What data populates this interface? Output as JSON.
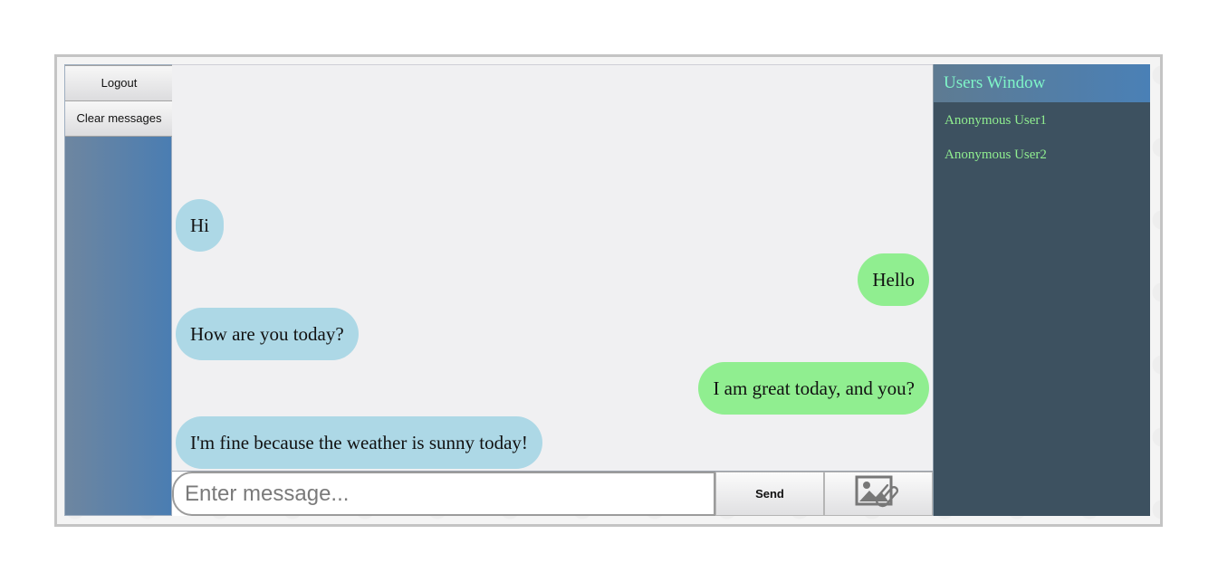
{
  "sidebar": {
    "buttons": [
      {
        "label": "Logout"
      },
      {
        "label": "Clear messages"
      }
    ]
  },
  "chat": {
    "messages": [
      {
        "text": "Hi",
        "direction": "incoming",
        "color": "#add8e6"
      },
      {
        "text": "Hello",
        "direction": "outgoing",
        "color": "#90ee90"
      },
      {
        "text": "How are you today?",
        "direction": "incoming",
        "color": "#add8e6"
      },
      {
        "text": "I am great today, and you?",
        "direction": "outgoing",
        "color": "#90ee90"
      },
      {
        "text": "I'm fine because the weather is sunny today!",
        "direction": "incoming",
        "color": "#add8e6"
      }
    ]
  },
  "composer": {
    "placeholder": "Enter message...",
    "value": "",
    "send_label": "Send",
    "attach_icon": "image-attachment-icon"
  },
  "users_window": {
    "title": "Users Window",
    "users": [
      {
        "name": "Anonymous User1"
      },
      {
        "name": "Anonymous User2"
      }
    ]
  },
  "colors": {
    "incoming_bubble": "#add8e6",
    "outgoing_bubble": "#90ee90",
    "users_panel_bg": "#3d5160",
    "users_header_text": "#7ff5c8",
    "user_item_text": "#90ee90"
  }
}
